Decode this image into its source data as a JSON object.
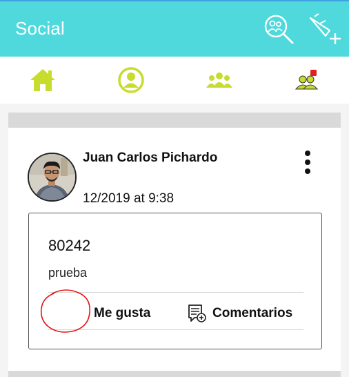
{
  "appbar": {
    "title": "Social",
    "actions": [
      {
        "icon": "search-friends-icon"
      },
      {
        "icon": "add-post-icon"
      }
    ]
  },
  "nav": {
    "items": [
      {
        "icon": "home-icon"
      },
      {
        "icon": "profile-icon"
      },
      {
        "icon": "groups-icon"
      },
      {
        "icon": "friend-requests-icon"
      }
    ],
    "accent": "#c8dc2e"
  },
  "post": {
    "author": "Juan Carlos Pichardo",
    "timestamp": "12/2019 at 9:38",
    "code": "80242",
    "text": "prueba",
    "like_label": "Me gusta",
    "comments_label": "Comentarios"
  },
  "colors": {
    "appbar": "#4fd9dc",
    "accent": "#c8dc2e",
    "annotation": "#e01515"
  }
}
